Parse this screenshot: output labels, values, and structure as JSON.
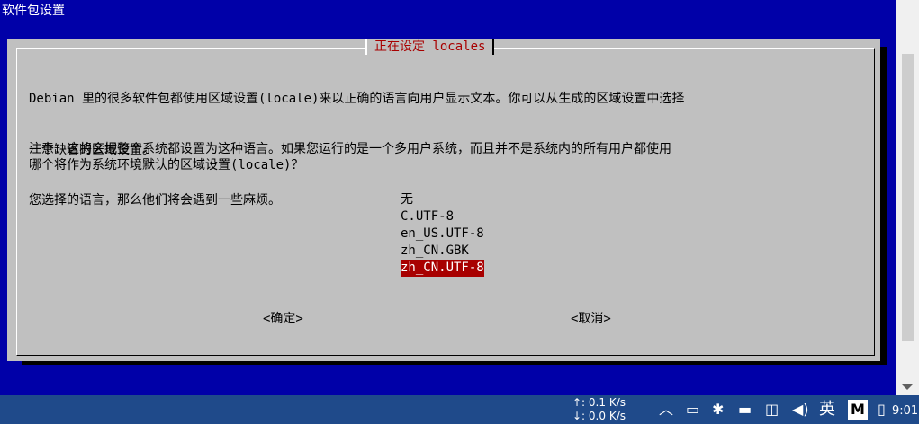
{
  "window": {
    "title": "软件包设置"
  },
  "dialog": {
    "title": "正在设定 locales",
    "paragraph1_line1": "Debian 里的很多软件包都使用区域设置(locale)来以正确的语言向用户显示文本。你可以从生成的区域设置中选择",
    "paragraph1_line2": "一个缺省的区域设置。",
    "paragraph2_line1": "注意：这将会把整个系统都设置为这种语言。如果您运行的是一个多用户系统，而且并不是系统内的所有用户都使用",
    "paragraph2_line2": "您选择的语言，那么他们将会遇到一些麻烦。",
    "question": "哪个将作为系统环境默认的区域设置(locale)？",
    "options": [
      "无",
      "C.UTF-8",
      "en_US.UTF-8",
      "zh_CN.GBK",
      "zh_CN.UTF-8"
    ],
    "selected_option": "zh_CN.UTF-8",
    "ok_label": "<确定>",
    "cancel_label": "<取消>"
  },
  "taskbar": {
    "upload_speed": "0.1 K/s",
    "download_speed": "0.0 K/s",
    "ime_label": "英",
    "m_label": "M",
    "clock": "9:01"
  },
  "colors": {
    "terminal_bg": "#0000a8",
    "dialog_bg": "#c0c0c0",
    "accent_red": "#a80000",
    "taskbar_bg": "#1f4a8a"
  },
  "icons": [
    "chevron-up-icon",
    "tablet-icon",
    "bluetooth-icon",
    "battery-icon",
    "network-icon",
    "volume-icon",
    "message-icon"
  ]
}
